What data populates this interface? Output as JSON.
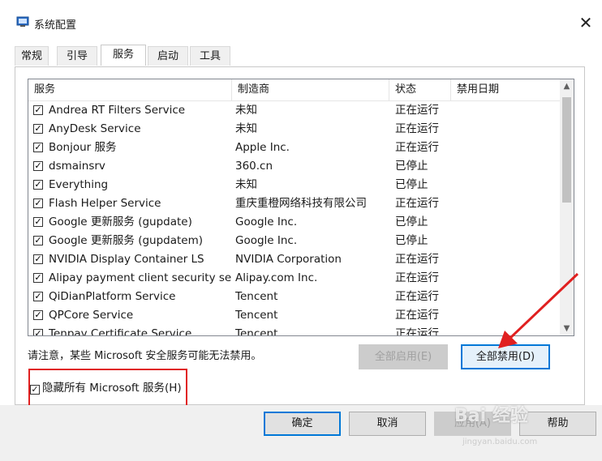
{
  "window": {
    "title": "系统配置",
    "close_glyph": "✕"
  },
  "tabs": [
    {
      "label": "常规"
    },
    {
      "label": "引导"
    },
    {
      "label": "服务",
      "active": true
    },
    {
      "label": "启动"
    },
    {
      "label": "工具"
    }
  ],
  "services": {
    "columns": {
      "name": "服务",
      "manufacturer": "制造商",
      "status": "状态",
      "disabled_date": "禁用日期"
    },
    "rows": [
      {
        "checked": true,
        "name": "Andrea RT Filters Service",
        "manufacturer": "未知",
        "status": "正在运行"
      },
      {
        "checked": true,
        "name": "AnyDesk Service",
        "manufacturer": "未知",
        "status": "正在运行"
      },
      {
        "checked": true,
        "name": "Bonjour 服务",
        "manufacturer": "Apple Inc.",
        "status": "正在运行"
      },
      {
        "checked": true,
        "name": "dsmainsrv",
        "manufacturer": "360.cn",
        "status": "已停止"
      },
      {
        "checked": true,
        "name": "Everything",
        "manufacturer": "未知",
        "status": "已停止"
      },
      {
        "checked": true,
        "name": "Flash Helper Service",
        "manufacturer": "重庆重橙网络科技有限公司",
        "status": "正在运行"
      },
      {
        "checked": true,
        "name": "Google 更新服务 (gupdate)",
        "manufacturer": "Google Inc.",
        "status": "已停止"
      },
      {
        "checked": true,
        "name": "Google 更新服务 (gupdatem)",
        "manufacturer": "Google Inc.",
        "status": "已停止"
      },
      {
        "checked": true,
        "name": "NVIDIA Display Container LS",
        "manufacturer": "NVIDIA Corporation",
        "status": "正在运行"
      },
      {
        "checked": true,
        "name": "Alipay payment client security ser...",
        "manufacturer": "Alipay.com Inc.",
        "status": "正在运行"
      },
      {
        "checked": true,
        "name": "QiDianPlatform Service",
        "manufacturer": "Tencent",
        "status": "正在运行"
      },
      {
        "checked": true,
        "name": "QPCore Service",
        "manufacturer": "Tencent",
        "status": "正在运行"
      },
      {
        "checked": true,
        "name": "Tenpay Certificate Service",
        "manufacturer": "Tencent",
        "status": "正在运行"
      }
    ]
  },
  "note": "请注意，某些 Microsoft 安全服务可能无法禁用。",
  "buttons": {
    "enable_all": "全部启用(E)",
    "disable_all": "全部禁用(D)",
    "ok": "确定",
    "cancel": "取消",
    "apply": "应用(A)",
    "help": "帮助"
  },
  "hide_ms": {
    "checked": true,
    "label": "隐藏所有 Microsoft 服务(H)"
  },
  "watermark": {
    "text": "Bai 经验",
    "sub": "jingyan.baidu.com"
  },
  "colors": {
    "accent": "#0078d7",
    "annotation_red": "#e02020"
  }
}
